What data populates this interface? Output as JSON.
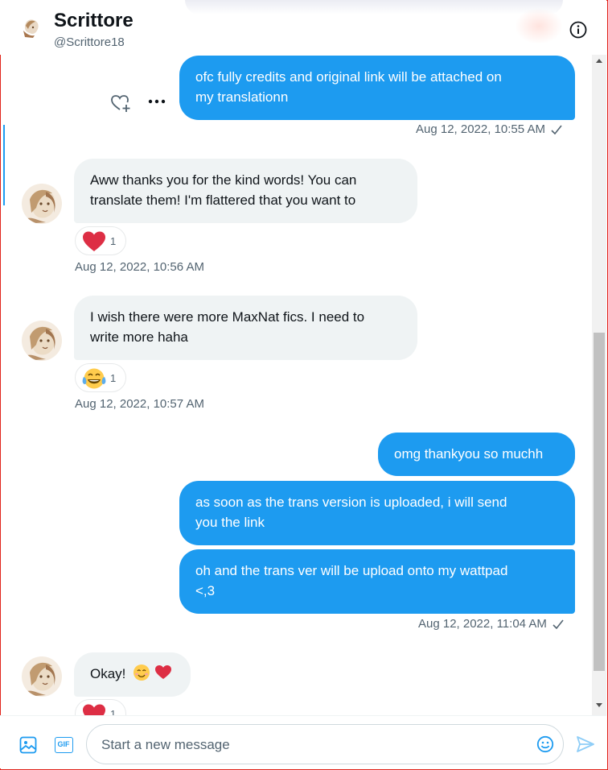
{
  "header": {
    "title": "Scrittore",
    "handle": "@Scrittore18"
  },
  "messages": [
    {
      "id": "m1",
      "direction": "out",
      "lines": [
        "ofc fully credits and original link will be attached on",
        "my translationn"
      ]
    },
    {
      "id": "m1ts",
      "timestamp": "Aug 12, 2022, 10:55 AM"
    },
    {
      "id": "m2",
      "direction": "in",
      "lines": [
        "Aww thanks you for the kind words! You can",
        "translate them! I'm flattered that you want to"
      ],
      "reaction": {
        "emoji": "red-heart",
        "count": "1"
      },
      "timestamp": "Aug 12, 2022, 10:56 AM"
    },
    {
      "id": "m3",
      "direction": "in",
      "lines": [
        "I wish there were more MaxNat fics. I need to",
        "write more haha"
      ],
      "reaction": {
        "emoji": "tears-of-joy",
        "count": "1"
      },
      "timestamp": "Aug 12, 2022, 10:57 AM"
    },
    {
      "id": "m4",
      "direction": "out",
      "lines": [
        "omg thankyou so muchh"
      ]
    },
    {
      "id": "m5",
      "direction": "out",
      "lines": [
        "as soon as the trans version is uploaded, i will send",
        "you the link"
      ]
    },
    {
      "id": "m6",
      "direction": "out",
      "lines": [
        "oh and the trans ver will be upload onto my wattpad",
        "<,3"
      ],
      "timestamp": "Aug 12, 2022, 11:04 AM"
    },
    {
      "id": "m7",
      "direction": "in",
      "text": "Okay!",
      "reaction": {
        "emoji": "red-heart",
        "count": "1"
      }
    }
  ],
  "composer": {
    "placeholder": "Start a new message",
    "gif_label": "GIF"
  },
  "colors": {
    "accent": "#1d9bf0",
    "incoming_bubble": "#eff3f4",
    "secondary_text": "#536471",
    "frame_border": "#e0241b"
  }
}
